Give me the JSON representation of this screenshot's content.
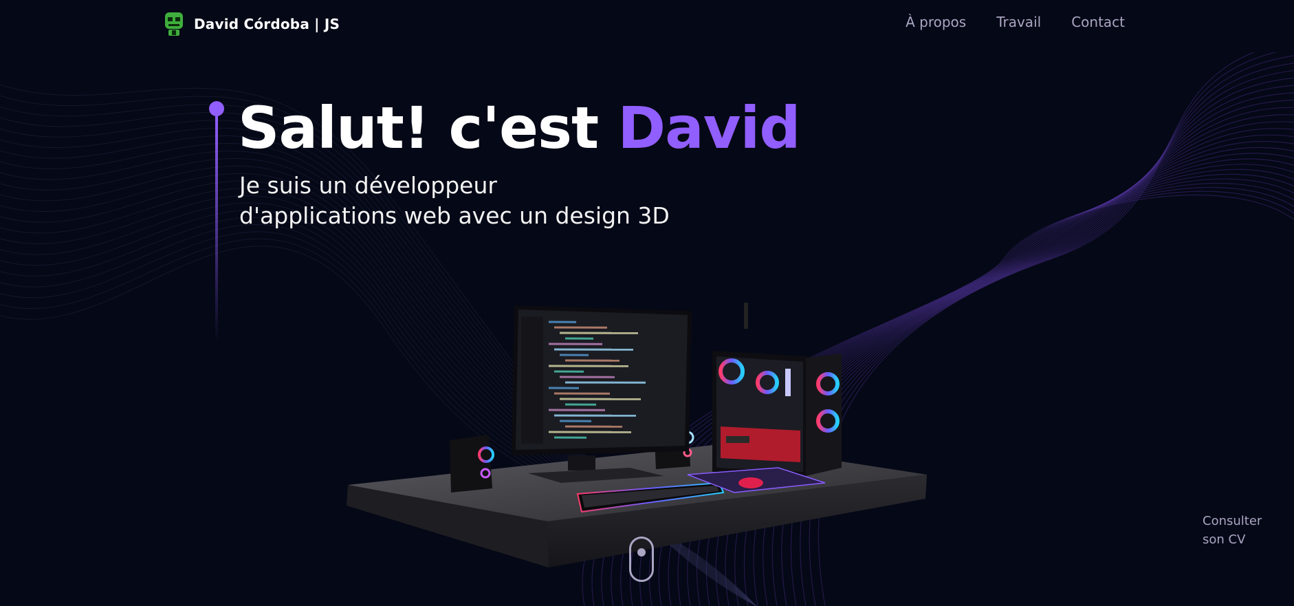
{
  "nav": {
    "brand": "David Córdoba  | JS",
    "links": [
      "À propos",
      "Travail",
      "Contact"
    ],
    "logo_icon": "robot-logo-icon"
  },
  "hero": {
    "title_prefix": "Salut! c'est",
    "title_name": "David",
    "subtitle_line1": "Je suis un développeur",
    "subtitle_line2": "d'applications web avec un design 3D"
  },
  "cv_link": {
    "line1": "Consulter",
    "line2": "son CV"
  },
  "colors": {
    "background": "#050816",
    "accent": "#915eff",
    "secondary_text": "#aaa6c3",
    "logo_green": "#3fae3c"
  },
  "icons": {
    "scroll": "mouse-scroll-icon"
  }
}
